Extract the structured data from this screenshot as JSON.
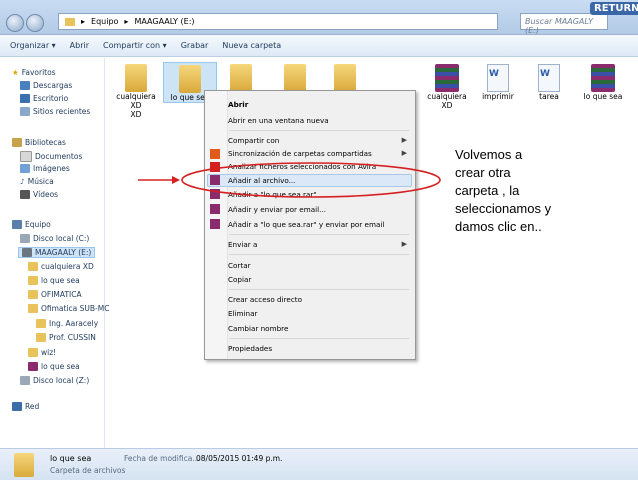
{
  "window": {
    "title": "(blurred title)"
  },
  "address": {
    "crumbs": [
      "Equipo",
      "MAAGAALY (E:)"
    ],
    "search_placeholder": "Buscar MAAGALY (E:)"
  },
  "corner_badge": "RETURN",
  "toolbar": {
    "items": [
      "Organizar ▾",
      "Abrir",
      "Compartir con ▾",
      "Grabar",
      "Nueva carpeta"
    ]
  },
  "nav": {
    "favorites": "Favoritos",
    "fav_items": [
      "Descargas",
      "Escritorio",
      "Sitios recientes"
    ],
    "libraries": "Bibliotecas",
    "lib_items": [
      "Documentos",
      "Imágenes",
      "Música",
      "Vídeos"
    ],
    "computer": "Equipo",
    "drives": [
      "Disco local (C:)",
      "MAAGAALY (E:)"
    ],
    "subitems": [
      "cualquiera XD",
      "lo que sea",
      "OFIMATICA",
      "Ofimatica SUB-MC",
      "Ing. Aaracely",
      "Prof. CUSSIN",
      "wiz!",
      "lo que sea",
      "Disco local (Z:)"
    ],
    "network": "Red"
  },
  "files": [
    {
      "label": "cualquiera XD",
      "kind": "folder"
    },
    {
      "label": "lo que sea",
      "kind": "folder"
    },
    {
      "label": "",
      "kind": "folder"
    },
    {
      "label": "",
      "kind": "folder"
    },
    {
      "label": "",
      "kind": "folder"
    },
    {
      "label": "cualquiera XD",
      "kind": "rar"
    },
    {
      "label": "imprimir",
      "kind": "word"
    },
    {
      "label": "tarea",
      "kind": "word"
    },
    {
      "label": "lo que sea",
      "kind": "rar"
    }
  ],
  "context_menu": [
    "Abrir",
    "Abrir en una ventana nueva",
    "Compartir con",
    "Sincronización de carpetas compartidas",
    "Analizar ficheros seleccionados con Avira",
    "Añadir al archivo...",
    "Añadir a \"lo que sea.rar\"",
    "Añadir y enviar por email...",
    "Añadir a \"lo que sea.rar\" y enviar por email",
    "Enviar a",
    "Cortar",
    "Copiar",
    "Crear acceso directo",
    "Eliminar",
    "Cambiar nombre",
    "Propiedades"
  ],
  "details": {
    "name": "lo que sea",
    "type": "Carpeta de archivos",
    "modified_label": "Fecha de modifica...",
    "modified_value": "08/05/2015 01:49 p.m."
  },
  "annotation": {
    "lines": [
      "Volvemos a",
      "crear otra",
      "carpeta , la",
      "seleccionamos y",
      "damos clic en.."
    ]
  },
  "colors": {
    "accent": "#3a67a8",
    "annotation_red": "#d62020",
    "folder": "#e8c25a"
  }
}
